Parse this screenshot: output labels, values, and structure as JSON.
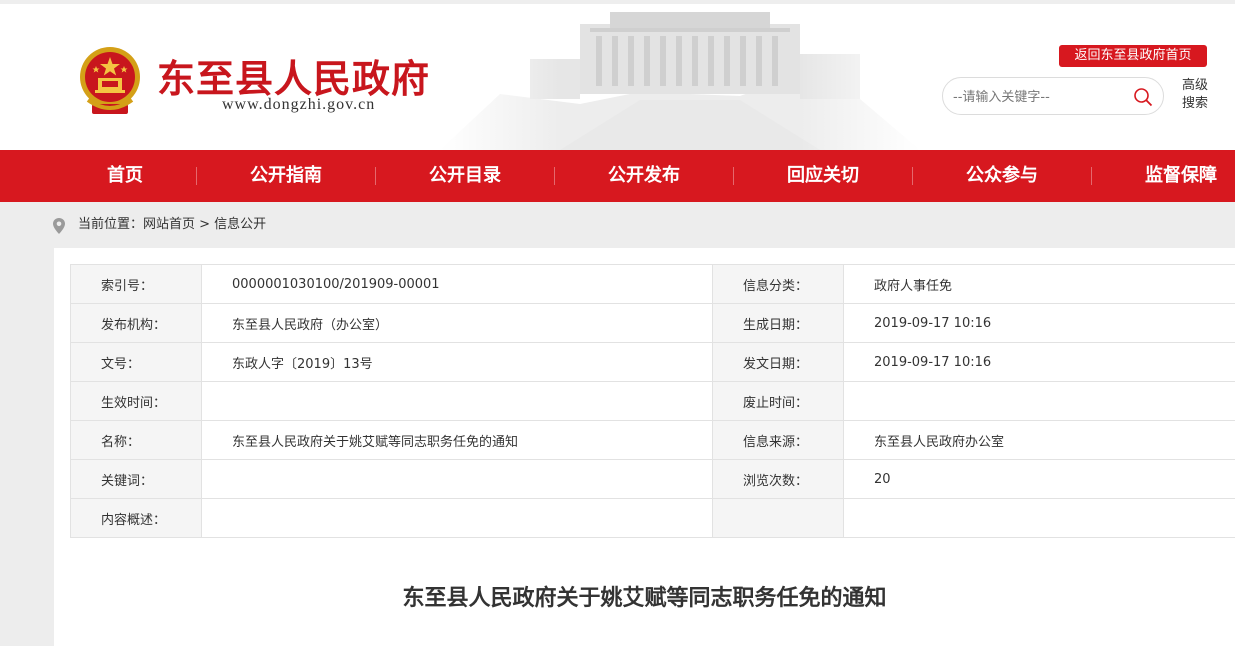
{
  "header": {
    "site_title": "东至县人民政府",
    "site_url": "www.dongzhi.gov.cn",
    "home_link": "返回东至县政府首页",
    "search_placeholder": "--请输入关键字--",
    "advanced_search": "高级搜索"
  },
  "nav": {
    "items": [
      {
        "label": "首页"
      },
      {
        "label": "公开指南"
      },
      {
        "label": "公开目录"
      },
      {
        "label": "公开发布"
      },
      {
        "label": "回应关切"
      },
      {
        "label": "公众参与"
      },
      {
        "label": "监督保障"
      }
    ]
  },
  "breadcrumb": {
    "text": "当前位置：网站首页 > 信息公开"
  },
  "meta_table": {
    "rows": [
      {
        "l1": "索引号：",
        "v1": "0000001030100/201909-00001",
        "l2": "信息分类：",
        "v2": "政府人事任免"
      },
      {
        "l1": "发布机构：",
        "v1": "东至县人民政府（办公室）",
        "l2": "生成日期：",
        "v2": "2019-09-17 10:16"
      },
      {
        "l1": "文号：",
        "v1": "东政人字〔2019〕13号",
        "l2": "发文日期：",
        "v2": "2019-09-17 10:16"
      },
      {
        "l1": "生效时间：",
        "v1": "",
        "l2": "废止时间：",
        "v2": ""
      },
      {
        "l1": "名称：",
        "v1": "东至县人民政府关于姚艾赋等同志职务任免的通知",
        "l2": "信息来源：",
        "v2": "东至县人民政府办公室"
      },
      {
        "l1": "关键词：",
        "v1": "",
        "l2": "浏览次数：",
        "v2": "20"
      },
      {
        "l1": "内容概述：",
        "v1": "",
        "l2": "",
        "v2": ""
      }
    ]
  },
  "article": {
    "title": "东至县人民政府关于姚艾赋等同志职务任免的通知"
  },
  "colors": {
    "brand_red": "#d7181f",
    "title_red": "#c8161d"
  },
  "icons": [
    "national-emblem-icon",
    "search-icon",
    "location-pin-icon"
  ]
}
